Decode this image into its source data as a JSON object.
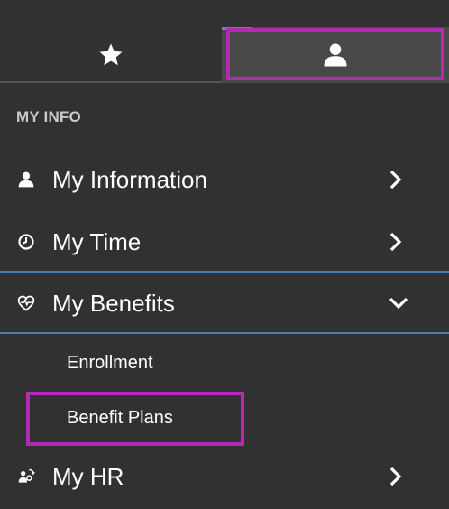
{
  "tabs": {
    "favorites": {
      "icon": "star-icon"
    },
    "me": {
      "icon": "person-icon",
      "selected": true
    }
  },
  "section": {
    "title": "MY INFO"
  },
  "menu": [
    {
      "label": "My Information",
      "icon": "person-icon",
      "expanded": false
    },
    {
      "label": "My Time",
      "icon": "clock-icon",
      "expanded": false
    },
    {
      "label": "My Benefits",
      "icon": "heart-benefits-icon",
      "expanded": true,
      "subitems": [
        {
          "label": "Enrollment"
        },
        {
          "label": "Benefit Plans"
        }
      ]
    },
    {
      "label": "My HR",
      "icon": "hr-people-icon",
      "expanded": false
    }
  ],
  "colors": {
    "background": "#313131",
    "divider": "#3f7fbf",
    "highlight": "#b52ab5",
    "text": "#ffffff",
    "muted": "#c9c9c9"
  }
}
